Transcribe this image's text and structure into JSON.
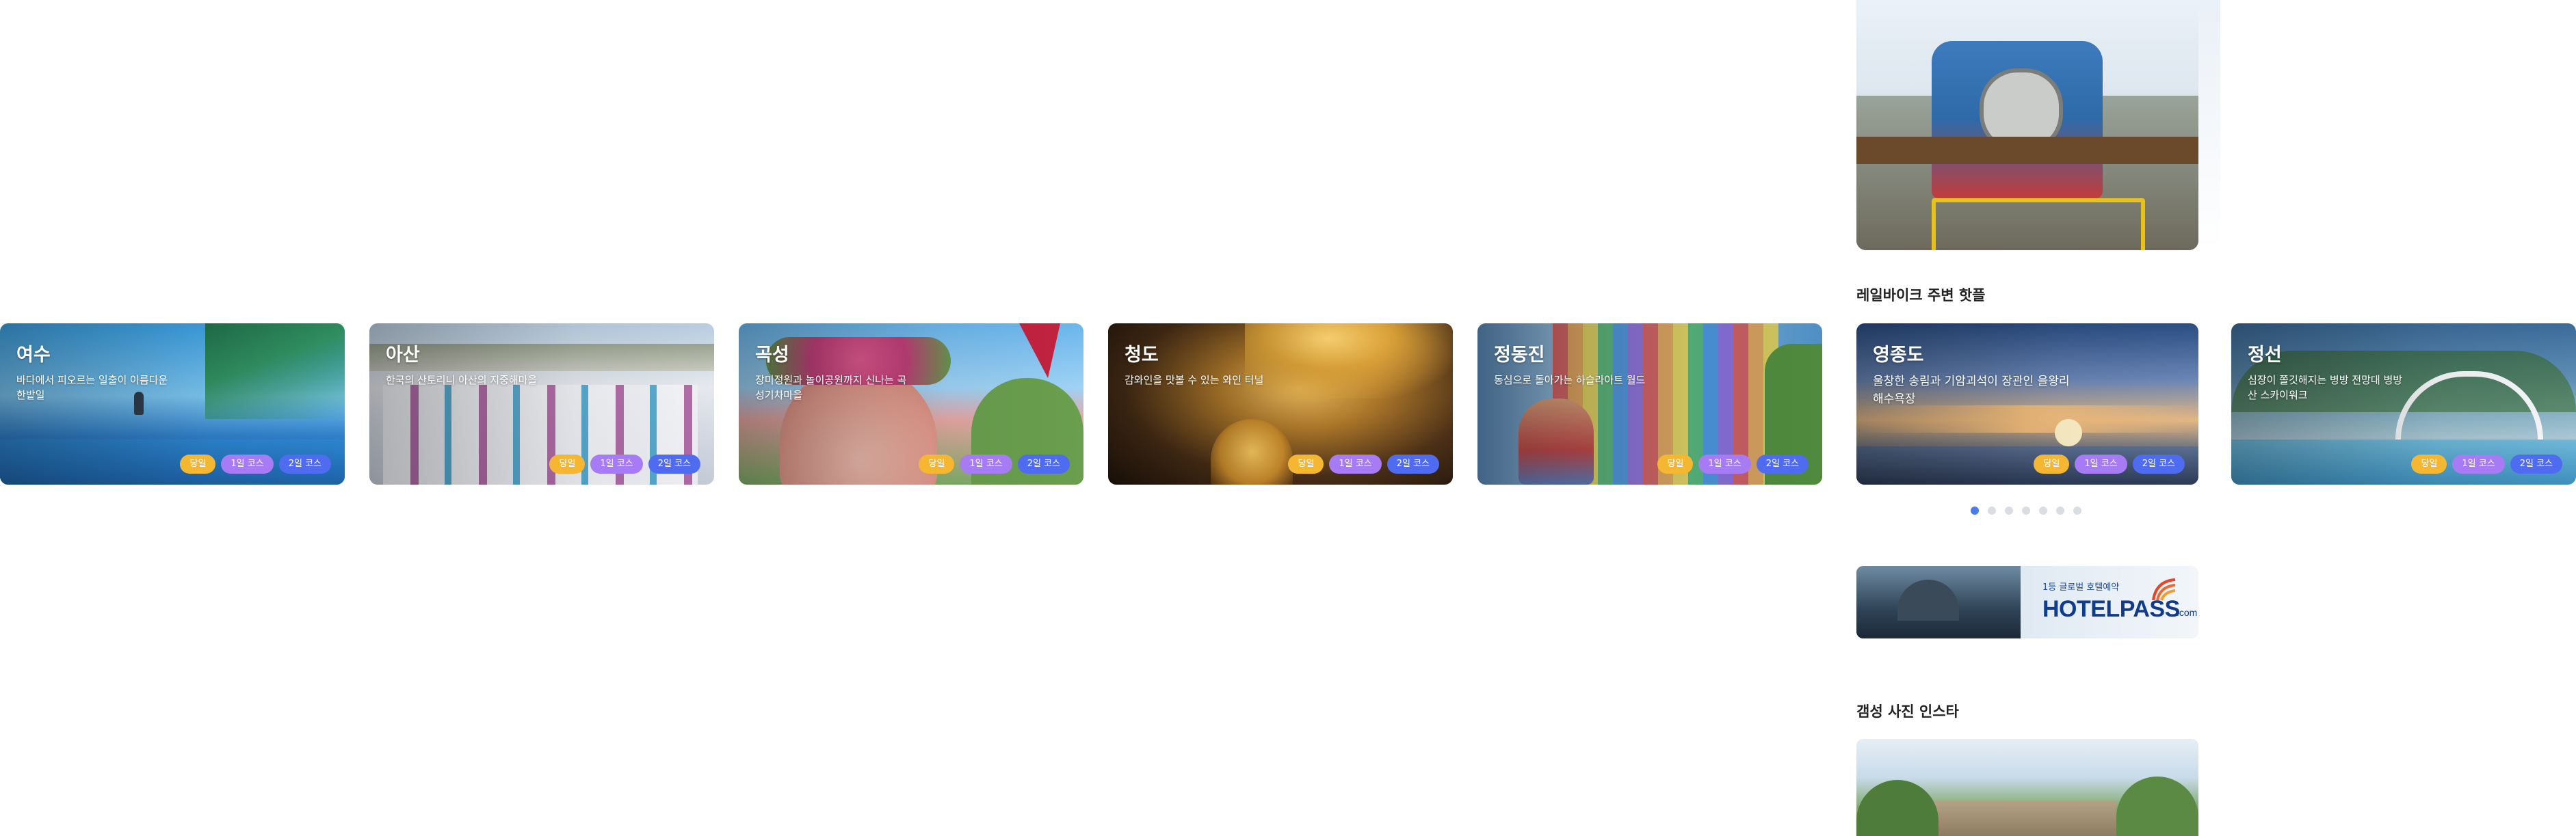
{
  "sections": {
    "railbike_hot": "레일바이크 주변 핫플",
    "instagram": "갬성 사진 인스타"
  },
  "course_labels": {
    "day": "당일",
    "one_night": "1일 코스",
    "two_night": "2일 코스"
  },
  "region_cards": [
    {
      "title": "여수",
      "desc": "바다에서 피오르는 일출이 아름다운 한밭일"
    },
    {
      "title": "아산",
      "desc": "한국의 산토리니 아산의 지중해마을"
    },
    {
      "title": "곡성",
      "desc": "장미정원과 놀이공원까지 신나는 곡성기차마을"
    },
    {
      "title": "청도",
      "desc": "감와인을 맛볼 수 있는 와인 터널"
    },
    {
      "title": "정동진",
      "desc": "동심으로 돌아가는 하슬라아트 월드"
    }
  ],
  "hotplace_cards": [
    {
      "title": "영종도",
      "desc": "울창한 송림과 기암괴석이 장관인 을왕리 해수욕장"
    },
    {
      "title": "정선",
      "desc": "심장이 쫄깃해지는 병방 전망대 병방산 스카이워크"
    }
  ],
  "carousel": {
    "count": 7,
    "active_index": 0
  },
  "banner": {
    "subtitle": "1등 글로벌 호텔예약",
    "brand": "HOTELPASS",
    "brand_suffix": ".com"
  },
  "colors": {
    "pill_day": "#f5b731",
    "pill_one_night": "#a77bf3",
    "pill_two_night": "#4f6bf0",
    "dot_active": "#4a7cf0",
    "dot_inactive": "#d9dde4"
  }
}
